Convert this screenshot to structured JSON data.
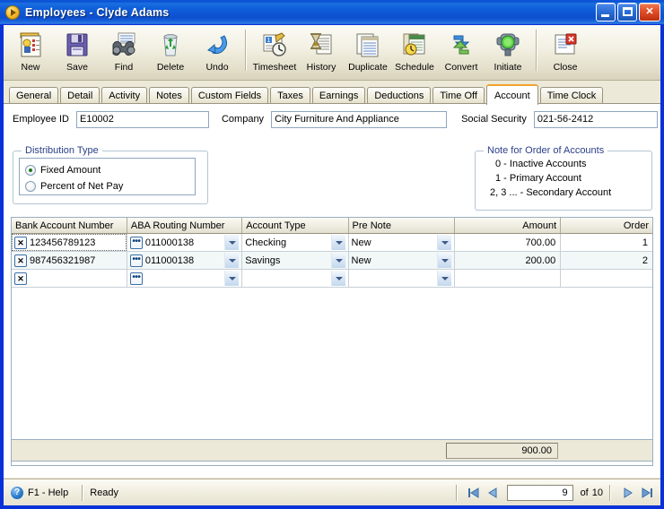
{
  "window": {
    "title": "Employees - Clyde Adams",
    "icon": "app-play-icon",
    "buttons": {
      "minimize": "Minimize",
      "maximize": "Maximize",
      "close": "✕"
    }
  },
  "toolbar": {
    "items": [
      {
        "label": "New",
        "icon": "new-record-icon"
      },
      {
        "label": "Save",
        "icon": "floppy-disk-icon"
      },
      {
        "label": "Find",
        "icon": "binoculars-icon"
      },
      {
        "label": "Delete",
        "icon": "recycle-bin-icon"
      },
      {
        "label": "Undo",
        "icon": "undo-arrow-icon"
      },
      {
        "label": "Timesheet",
        "icon": "timesheet-clock-icon"
      },
      {
        "label": "History",
        "icon": "hourglass-history-icon"
      },
      {
        "label": "Duplicate",
        "icon": "duplicate-pages-icon"
      },
      {
        "label": "Schedule",
        "icon": "schedule-calendar-icon"
      },
      {
        "label": "Convert",
        "icon": "convert-arrows-icon"
      },
      {
        "label": "Initiate",
        "icon": "traffic-light-icon"
      },
      {
        "label": "Close",
        "icon": "close-document-icon"
      }
    ]
  },
  "tabs": {
    "items": [
      {
        "label": "General"
      },
      {
        "label": "Detail"
      },
      {
        "label": "Activity"
      },
      {
        "label": "Notes"
      },
      {
        "label": "Custom Fields"
      },
      {
        "label": "Taxes"
      },
      {
        "label": "Earnings"
      },
      {
        "label": "Deductions"
      },
      {
        "label": "Time Off"
      },
      {
        "label": "Account"
      },
      {
        "label": "Time Clock"
      }
    ],
    "active": "Account"
  },
  "fields": {
    "employee_id_label": "Employee ID",
    "employee_id_value": "E10002",
    "company_label": "Company",
    "company_value": "City Furniture And Appliance",
    "social_security_label": "Social Security",
    "social_security_value": "021-56-2412"
  },
  "distribution_type": {
    "title": "Distribution Type",
    "options": [
      {
        "label": "Fixed Amount",
        "selected": true
      },
      {
        "label": "Percent of Net Pay",
        "selected": false
      }
    ]
  },
  "note_panel": {
    "title": "Note for Order of Accounts",
    "lines": [
      "0 - Inactive Accounts",
      "1 - Primary Account",
      "2, 3 ... - Secondary Account"
    ]
  },
  "grid": {
    "columns": [
      {
        "label": "Bank Account Number",
        "align": "left"
      },
      {
        "label": "ABA Routing Number",
        "align": "left"
      },
      {
        "label": "Account Type",
        "align": "left"
      },
      {
        "label": "Pre Note",
        "align": "left"
      },
      {
        "label": "Amount",
        "align": "right"
      },
      {
        "label": "Order",
        "align": "right"
      }
    ],
    "rows": [
      {
        "bank_account_number": "123456789123",
        "aba_routing_number": "011000138",
        "account_type": "Checking",
        "pre_note": "New",
        "amount": "700.00",
        "order": "1"
      },
      {
        "bank_account_number": "987456321987",
        "aba_routing_number": "011000138",
        "account_type": "Savings",
        "pre_note": "New",
        "amount": "200.00",
        "order": "2"
      },
      {
        "bank_account_number": "",
        "aba_routing_number": "",
        "account_type": "",
        "pre_note": "",
        "amount": "",
        "order": ""
      }
    ],
    "delete_button_glyph": "✕",
    "lookup_button_glyph": "•••"
  },
  "total": {
    "value": "900.00"
  },
  "statusbar": {
    "help_icon": "?",
    "help_label": "F1 - Help",
    "status": "Ready",
    "nav": {
      "first": "⏮",
      "previous": "◀",
      "current": "9",
      "of_label": "of",
      "total": "10",
      "next": "▶",
      "last": "⏭"
    }
  },
  "colors": {
    "titlebar_blue": "#0831d9",
    "window_chrome": "#ece9d8",
    "active_tab_accent": "#f0a32c",
    "group_label": "#2a3f88",
    "grid_alt_row": "#f2f8f8"
  }
}
